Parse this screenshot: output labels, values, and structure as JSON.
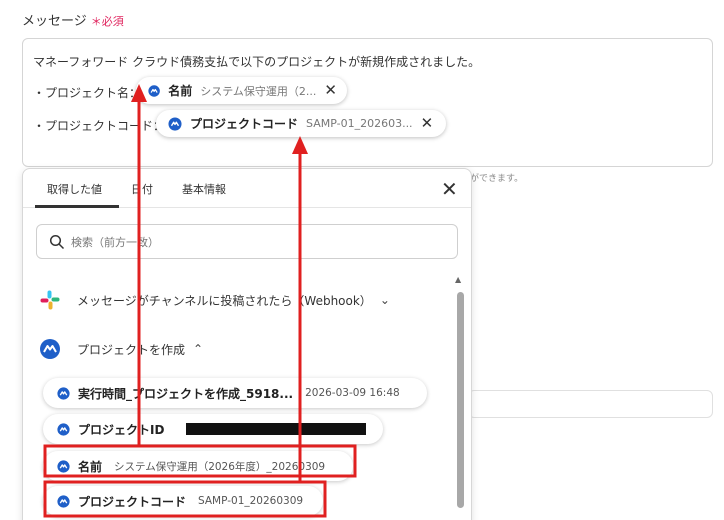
{
  "field": {
    "label": "メッセージ",
    "required": "＊必須"
  },
  "message": {
    "line1": "マネーフォワード クラウド債務支払で以下のプロジェクトが新規作成されました。",
    "line2_label": "・プロジェクト名：",
    "line3_label": "・プロジェクトコード：",
    "chip_name": {
      "label": "名前",
      "value": "システム保守運用（2..."
    },
    "chip_code": {
      "label": "プロジェクトコード",
      "value": "SAMP-01_202603..."
    }
  },
  "hint": "ができます。",
  "panel": {
    "tabs": [
      "取得した値",
      "日付",
      "基本情報"
    ],
    "search_placeholder": "検索（前方一致）",
    "groups": [
      {
        "label": "メッセージがチャンネルに投稿されたら（Webhook）",
        "icon": "slack-icon"
      },
      {
        "label": "プロジェクトを作成",
        "icon": "moneyforward-icon"
      }
    ],
    "items": [
      {
        "label": "実行時間_プロジェクトを作成_5918...",
        "value": "2026-03-09 16:48"
      },
      {
        "label": "プロジェクトID",
        "value": ""
      },
      {
        "label": "名前",
        "value": "システム保守運用（2026年度）_20260309"
      },
      {
        "label": "プロジェクトコード",
        "value": "SAMP-01_20260309"
      }
    ]
  },
  "colors": {
    "accent_blue": "#1f5fc8",
    "highlight_red": "#e02020",
    "required_pink": "#e0245e"
  }
}
